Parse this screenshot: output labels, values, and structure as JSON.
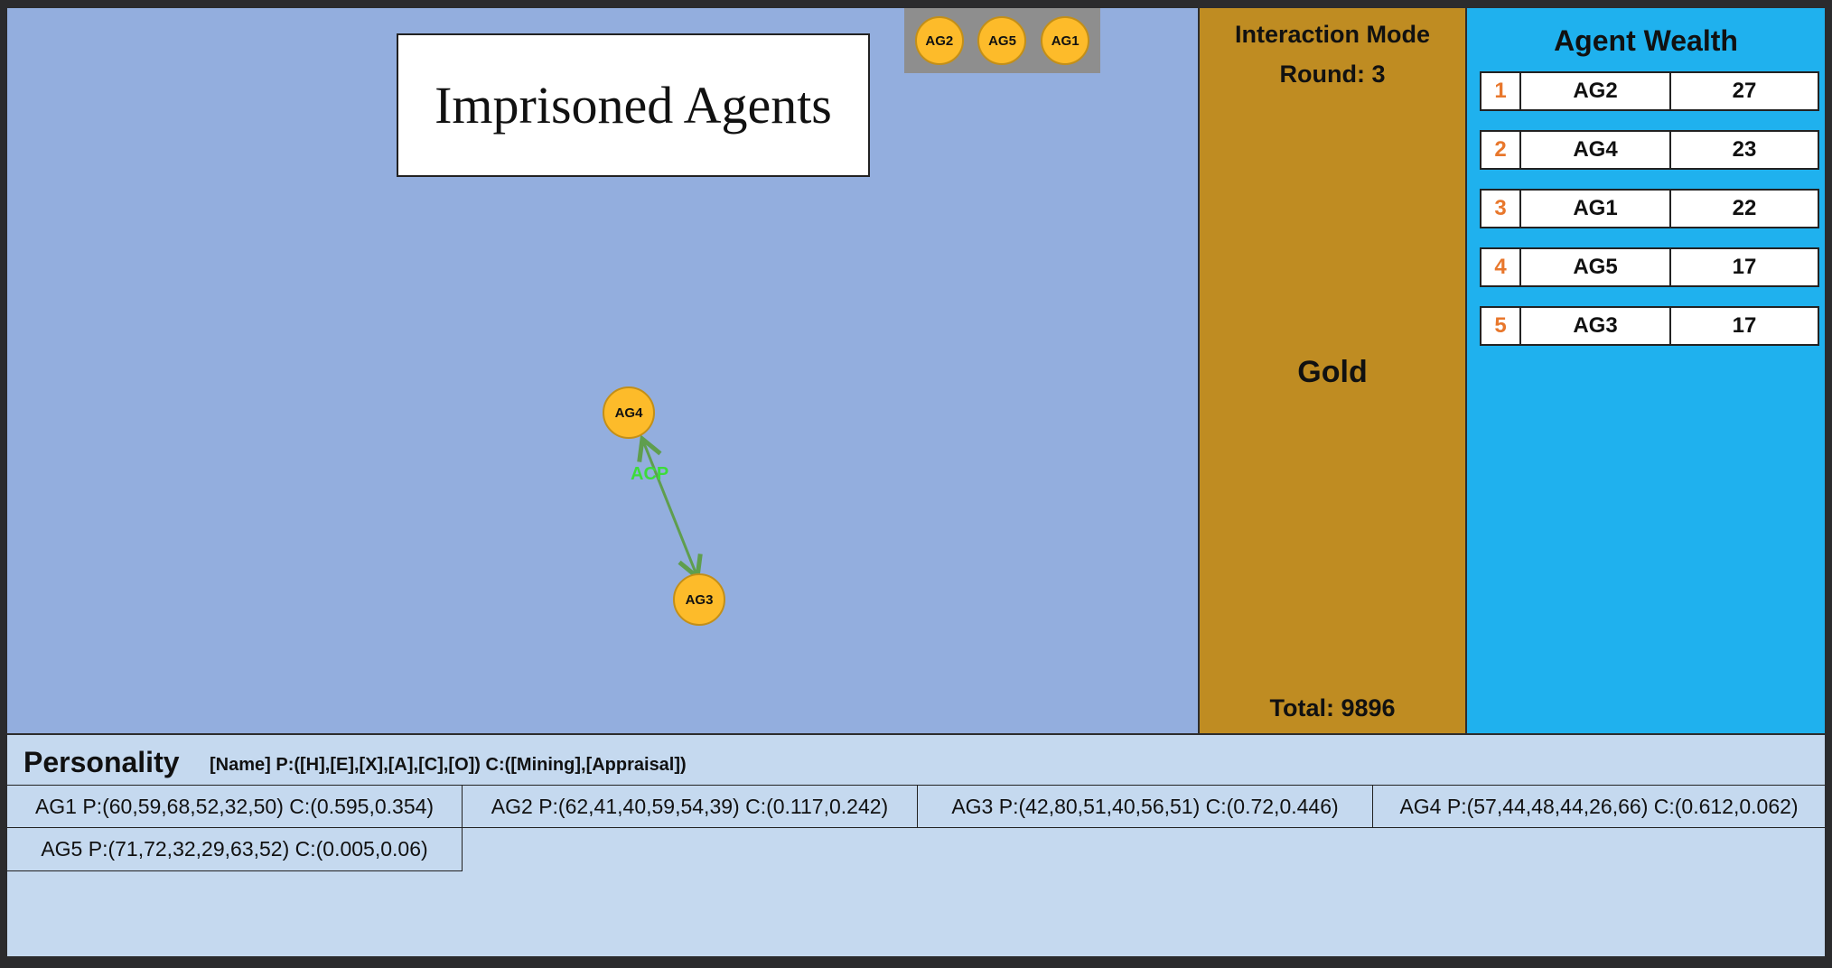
{
  "title": "Imprisoned Agents",
  "prison_agents": [
    "AG2",
    "AG5",
    "AG1"
  ],
  "interaction": {
    "source": "AG4",
    "target": "AG3",
    "label": "ACP"
  },
  "mode_panel": {
    "title": "Interaction Mode",
    "round": "Round: 3",
    "resource": "Gold",
    "total": "Total: 9896"
  },
  "wealth": {
    "title": "Agent Wealth",
    "rows": [
      {
        "rank": "1",
        "name": "AG2",
        "value": "27"
      },
      {
        "rank": "2",
        "name": "AG4",
        "value": "23"
      },
      {
        "rank": "3",
        "name": "AG1",
        "value": "22"
      },
      {
        "rank": "4",
        "name": "AG5",
        "value": "17"
      },
      {
        "rank": "5",
        "name": "AG3",
        "value": "17"
      }
    ]
  },
  "personality": {
    "title": "Personality",
    "legend": "[Name] P:([H],[E],[X],[A],[C],[O]) C:([Mining],[Appraisal])",
    "entries": [
      "AG1 P:(60,59,68,52,32,50) C:(0.595,0.354)",
      "AG2 P:(62,41,40,59,54,39) C:(0.117,0.242)",
      "AG3 P:(42,80,51,40,56,51) C:(0.72,0.446)",
      "AG4 P:(57,44,48,44,26,66) C:(0.612,0.062)",
      "AG5 P:(71,72,32,29,63,52) C:(0.005,0.06)"
    ]
  },
  "colors": {
    "simulation_bg": "#93aede",
    "agent_fill": "#fdbb2a",
    "mode_bg": "#bf8c22",
    "wealth_bg": "#1fb1ee",
    "edge": "#5f9e4e",
    "edge_label": "#3cdc3a",
    "rank_text": "#e8772c"
  }
}
